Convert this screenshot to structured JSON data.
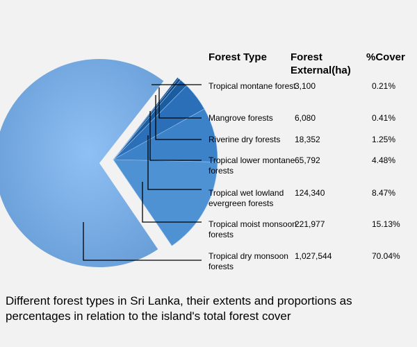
{
  "table": {
    "headers": {
      "type": "Forest Type",
      "extent": "Forest External(ha)",
      "percent": "%Cover"
    },
    "rows": [
      {
        "type": "Tropical montane forest",
        "extent": "3,100",
        "percent": "0.21%"
      },
      {
        "type": "Mangrove forests",
        "extent": "6,080",
        "percent": "0.41%"
      },
      {
        "type": "Riverine dry forests",
        "extent": "18,352",
        "percent": "1.25%"
      },
      {
        "type": "Tropical lower montane forests",
        "extent": "65,792",
        "percent": "4.48%"
      },
      {
        "type": "Tropical wet lowland evergreen forests",
        "extent": "124,340",
        "percent": "8.47%"
      },
      {
        "type": "Tropical moist monsoon forests",
        "extent": "221,977",
        "percent": "15.13%"
      },
      {
        "type": "Tropical dry monsoon forests",
        "extent": "1,027,544",
        "percent": "70.04%"
      }
    ]
  },
  "caption": "Different forest types in Sri Lanka, their extents and proportions as percentages in relation to the island's total forest cover",
  "chart_data": {
    "type": "pie",
    "categories": [
      "Tropical montane forest",
      "Mangrove forests",
      "Riverine dry forests",
      "Tropical lower montane forests",
      "Tropical wet lowland evergreen forests",
      "Tropical moist monsoon forests",
      "Tropical dry monsoon forests"
    ],
    "values": [
      0.21,
      0.41,
      1.25,
      4.48,
      8.47,
      15.13,
      70.04
    ],
    "extents_ha": [
      3100,
      6080,
      18352,
      65792,
      124340,
      221977,
      1027544
    ],
    "exploded": "all except Tropical dry monsoon forests",
    "colors": [
      "#0d3a6e",
      "#124b86",
      "#1a5c9e",
      "#2a6fb8",
      "#3c82c8",
      "#4f92d4",
      "#7fb2ea"
    ]
  }
}
